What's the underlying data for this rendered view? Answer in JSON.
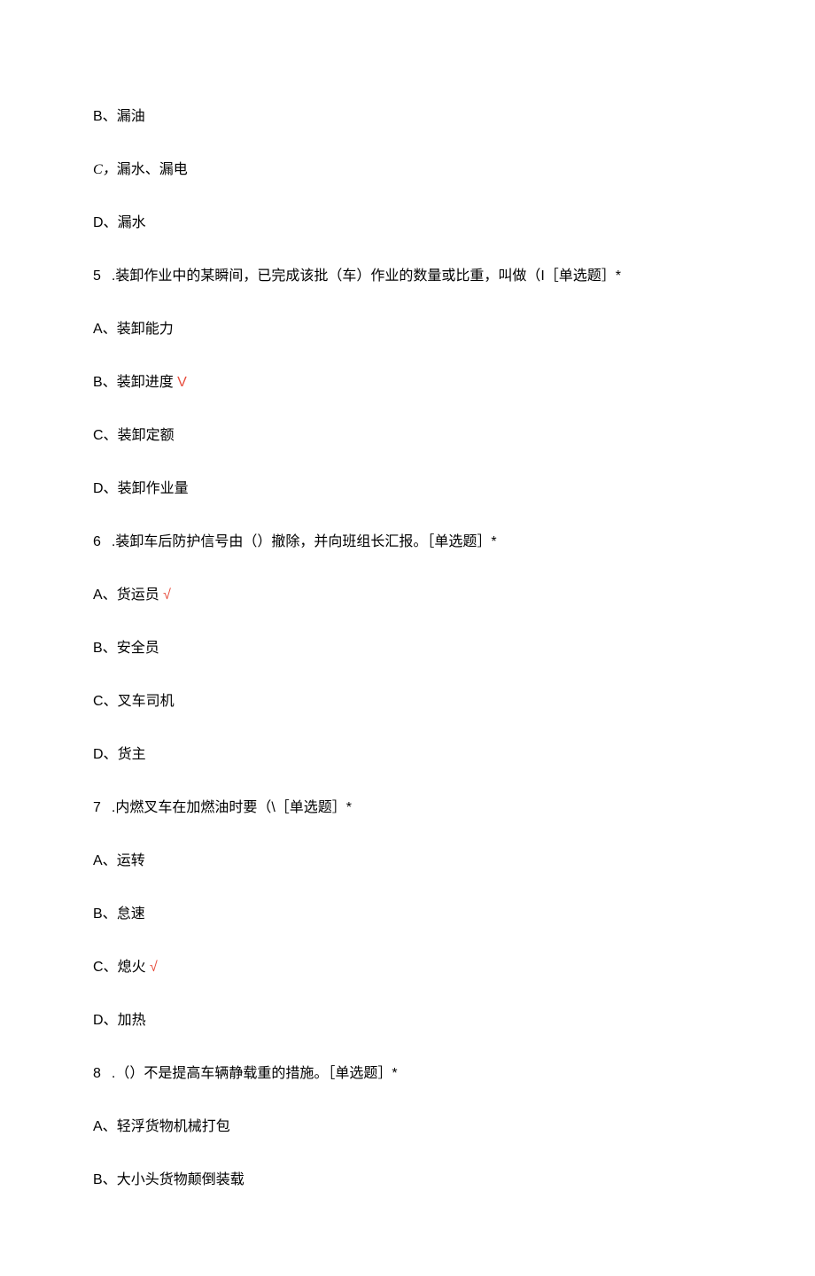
{
  "items": [
    {
      "type": "option",
      "prefix": "B、",
      "text": "漏油",
      "correct": false
    },
    {
      "type": "option_italic_c",
      "prefix": "C，",
      "text": "漏水、漏电",
      "correct": false
    },
    {
      "type": "option",
      "prefix": "D、",
      "text": "漏水",
      "correct": false
    },
    {
      "type": "question",
      "num": "5",
      "text": ".装卸作业中的某瞬间，已完成该批（车）作业的数量或比重，叫做（I［单选题］*"
    },
    {
      "type": "option",
      "prefix": "A、",
      "text": "装卸能力",
      "correct": false
    },
    {
      "type": "option",
      "prefix": "B、",
      "text": "装卸进度",
      "correct": true,
      "mark": "V"
    },
    {
      "type": "option",
      "prefix": "C、",
      "text": "装卸定额",
      "correct": false
    },
    {
      "type": "option",
      "prefix": "D、",
      "text": "装卸作业量",
      "correct": false
    },
    {
      "type": "question",
      "num": "6",
      "text": ".装卸车后防护信号由（）撤除，并向班组长汇报。［单选题］*"
    },
    {
      "type": "option",
      "prefix": "A、",
      "text": "货运员",
      "correct": true,
      "mark": "√"
    },
    {
      "type": "option",
      "prefix": "B、",
      "text": "安全员",
      "correct": false
    },
    {
      "type": "option",
      "prefix": "C、",
      "text": "叉车司机",
      "correct": false
    },
    {
      "type": "option",
      "prefix": "D、",
      "text": "货主",
      "correct": false
    },
    {
      "type": "question",
      "num": "7",
      "text": ".内燃叉车在加燃油时要（\\［单选题］*"
    },
    {
      "type": "option",
      "prefix": "A、",
      "text": "运转",
      "correct": false
    },
    {
      "type": "option",
      "prefix": "B、",
      "text": "怠速",
      "correct": false
    },
    {
      "type": "option",
      "prefix": "C、",
      "text": "熄火",
      "correct": true,
      "mark": "√"
    },
    {
      "type": "option",
      "prefix": "D、",
      "text": "加热",
      "correct": false
    },
    {
      "type": "question",
      "num": "8",
      "text": ".（）不是提高车辆静载重的措施。［单选题］*"
    },
    {
      "type": "option",
      "prefix": "A、",
      "text": "轻浮货物机械打包",
      "correct": false
    },
    {
      "type": "option",
      "prefix": "B、",
      "text": "大小头货物颠倒装载",
      "correct": false
    }
  ]
}
